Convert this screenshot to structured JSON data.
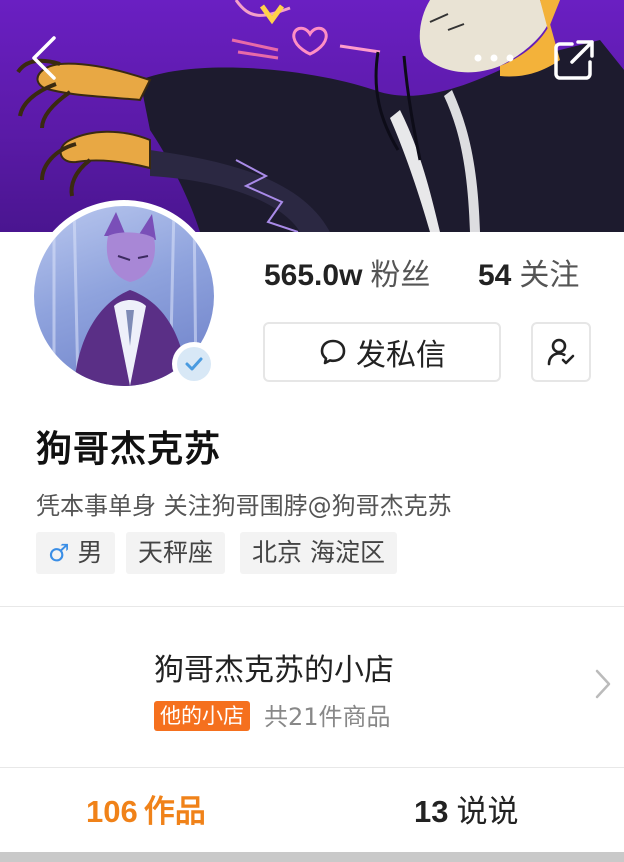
{
  "colors": {
    "banner_purple": "#5b1aa8",
    "accent_orange": "#f08219",
    "shop_badge_orange": "#f5701e",
    "male_blue": "#3a8ee6",
    "verified_blue": "#4a9be0"
  },
  "header": {
    "icons": [
      "back-arrow-icon",
      "more-dots-icon",
      "share-external-icon"
    ]
  },
  "profile": {
    "name": "狗哥杰克苏",
    "bio": "凭本事单身 关注狗哥围脖@狗哥杰克苏",
    "verified": true,
    "stats": {
      "fans_count": "565.0w",
      "fans_label": "粉丝",
      "following_count": "54",
      "following_label": "关注"
    },
    "actions": {
      "message_label": "发私信"
    },
    "tags": {
      "gender_symbol": "♂",
      "gender": "男",
      "zodiac": "天秤座",
      "location": "北京 海淀区"
    }
  },
  "shop": {
    "title": "狗哥杰克苏的小店",
    "badge": "他的小店",
    "count": "共21件商品"
  },
  "tabs": [
    {
      "count": "106",
      "label": "作品",
      "active": true
    },
    {
      "count": "13",
      "label": "说说",
      "active": false
    }
  ]
}
